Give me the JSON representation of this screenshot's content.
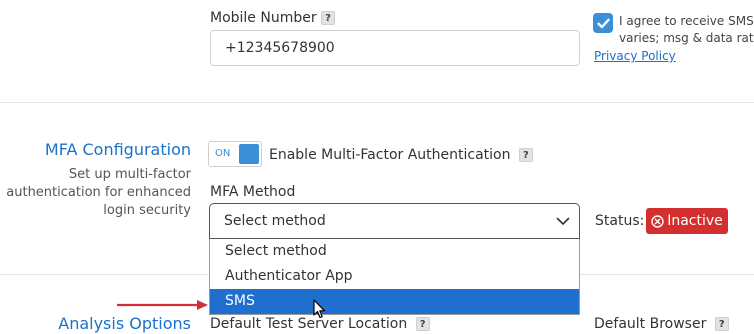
{
  "mobile": {
    "label": "Mobile Number",
    "help": "?",
    "value": "+12345678900"
  },
  "sms_consent": {
    "checked": true,
    "line1": "I agree to receive SMS co",
    "line2": "varies; msg & data rates",
    "link": "Privacy Policy"
  },
  "mfa_section": {
    "title": "MFA Configuration",
    "desc_line1": "Set up multi-factor",
    "desc_line2": "authentication for enhanced",
    "desc_line3": "login security"
  },
  "mfa_toggle": {
    "state_text": "ON",
    "label": "Enable Multi-Factor Authentication",
    "help": "?"
  },
  "mfa_method": {
    "label": "MFA Method",
    "selected": "Select method",
    "options": [
      "Select method",
      "Authenticator App",
      "SMS"
    ],
    "highlighted_index": 2
  },
  "status": {
    "label": "Status:",
    "badge": "Inactive",
    "badge_color": "#d32f2f"
  },
  "analysis_section": {
    "title": "Analysis Options"
  },
  "server_location": {
    "label": "Default Test Server Location",
    "help": "?"
  },
  "browser": {
    "label": "Default Browser",
    "help": "?"
  },
  "colors": {
    "accent": "#3a8fd8",
    "highlight": "#1e6fce",
    "section_title": "#1a73c9",
    "arrow": "#d0303a"
  }
}
